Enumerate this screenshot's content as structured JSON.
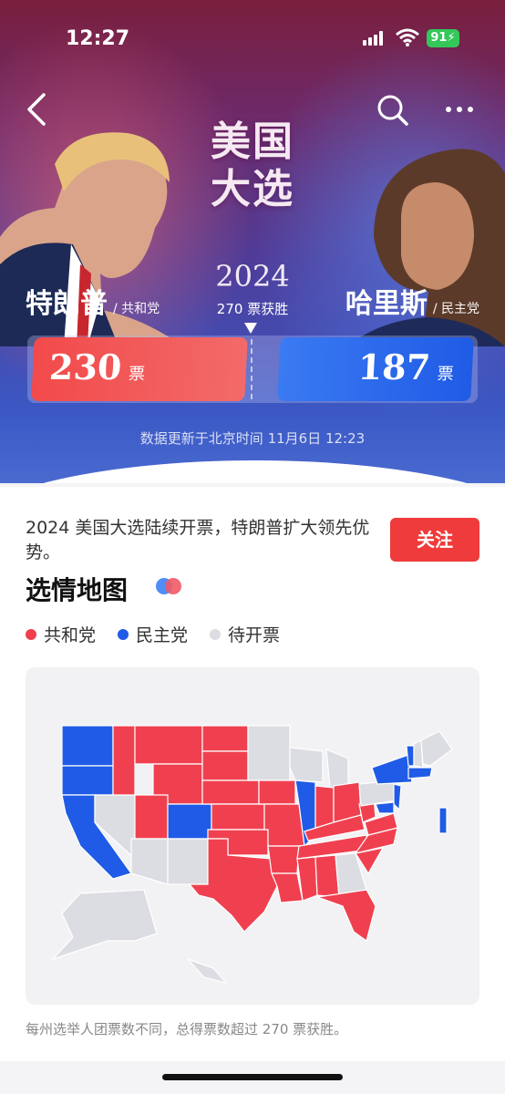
{
  "status_bar": {
    "time": "12:27",
    "battery": "91"
  },
  "hero": {
    "title_line1": "美国",
    "title_line2": "大选",
    "year": "2024",
    "win_rule": "270 票获胜",
    "left_candidate": {
      "name": "特朗普",
      "party": "/ 共和党",
      "votes": "230",
      "vote_unit": "票",
      "color": "#f24a4a"
    },
    "right_candidate": {
      "name": "哈里斯",
      "party": "/ 民主党",
      "votes": "187",
      "vote_unit": "票",
      "color": "#2563eb"
    },
    "update_time": "数据更新于北京时间 11月6日 12:23"
  },
  "article": {
    "headline": "2024 美国大选陆续开票，特朗普扩大领先优势。",
    "follow_label": "关注"
  },
  "map_section": {
    "title": "选情地图",
    "legend": [
      {
        "label": "共和党",
        "color": "#f0404f"
      },
      {
        "label": "民主党",
        "color": "#1f5be6"
      },
      {
        "label": "待开票",
        "color": "#dcdde2"
      }
    ],
    "footnote": "每州选举人团票数不同，总得票数超过 270 票获胜。"
  }
}
